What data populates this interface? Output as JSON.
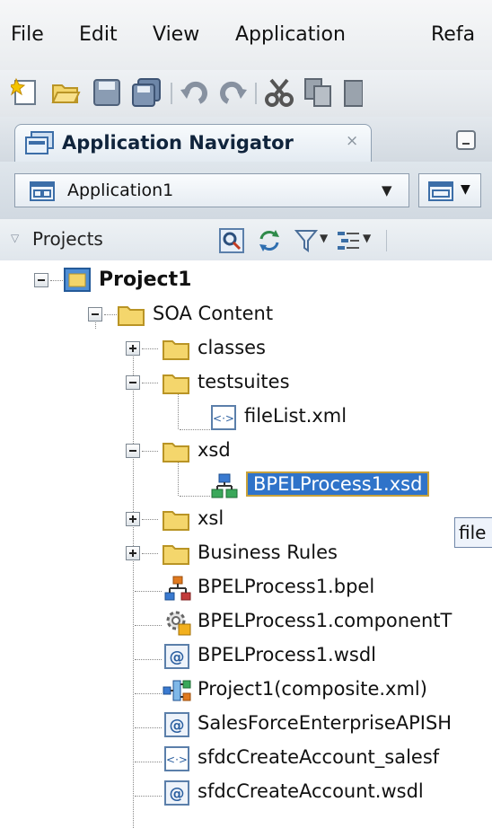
{
  "menubar": {
    "items": [
      {
        "label": "File"
      },
      {
        "label": "Edit"
      },
      {
        "label": "View"
      },
      {
        "label": "Application"
      },
      {
        "label": "Refa"
      }
    ]
  },
  "toolbar": {
    "icons": [
      "new-icon",
      "open-folder-icon",
      "save-icon",
      "save-all-icon",
      "undo-icon",
      "redo-icon",
      "cut-icon",
      "copy-icon",
      "paste-icon"
    ]
  },
  "navigator": {
    "tab_title": "Application Navigator",
    "tab_close": "×",
    "application": "Application1",
    "projects_label": "Projects"
  },
  "tree": {
    "items": [
      {
        "label": "Project1"
      },
      {
        "label": "SOA Content"
      },
      {
        "label": "classes"
      },
      {
        "label": "testsuites"
      },
      {
        "label": "fileList.xml"
      },
      {
        "label": "xsd"
      },
      {
        "label": "BPELProcess1.xsd"
      },
      {
        "label": "xsl"
      },
      {
        "label": "Business Rules"
      },
      {
        "label": "BPELProcess1.bpel"
      },
      {
        "label": "BPELProcess1.componentT"
      },
      {
        "label": "BPELProcess1.wsdl"
      },
      {
        "label": "Project1(composite.xml)"
      },
      {
        "label": "SalesForceEnterpriseAPISH"
      },
      {
        "label": "sfdcCreateAccount_salesf"
      },
      {
        "label": "sfdcCreateAccount.wsdl"
      }
    ]
  },
  "tooltip": {
    "text": "file"
  }
}
